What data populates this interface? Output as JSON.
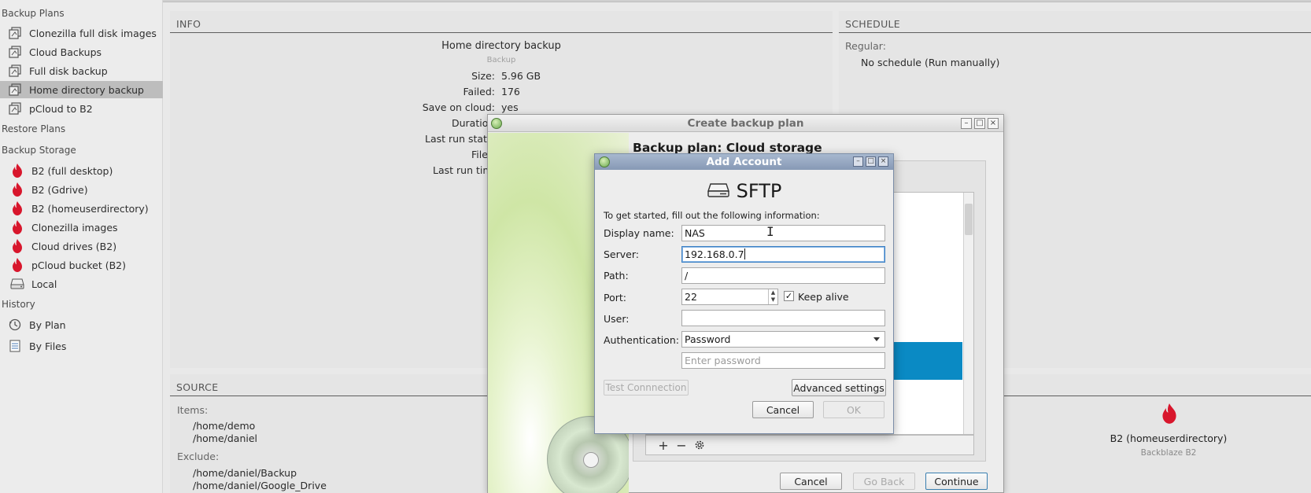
{
  "sidebar": {
    "backup_plans_heading": "Backup Plans",
    "backup_plans": [
      {
        "label": "Clonezilla full disk images"
      },
      {
        "label": "Cloud Backups"
      },
      {
        "label": "Full disk backup"
      },
      {
        "label": "Home directory backup",
        "selected": true
      },
      {
        "label": "pCloud to B2"
      }
    ],
    "restore_plans_heading": "Restore Plans",
    "backup_storage_heading": "Backup Storage",
    "storage": [
      {
        "label": "B2 (full desktop)",
        "icon": "backblaze-flame-icon"
      },
      {
        "label": "B2 (Gdrive)",
        "icon": "backblaze-flame-icon"
      },
      {
        "label": "B2 (homeuserdirectory)",
        "icon": "backblaze-flame-icon"
      },
      {
        "label": "Clonezilla images",
        "icon": "backblaze-flame-icon"
      },
      {
        "label": "Cloud drives (B2)",
        "icon": "backblaze-flame-icon"
      },
      {
        "label": "pCloud bucket (B2)",
        "icon": "backblaze-flame-icon"
      },
      {
        "label": "Local",
        "icon": "hard-drive-icon"
      }
    ],
    "history_heading": "History",
    "history": [
      {
        "label": "By Plan",
        "icon": "clock-history-icon"
      },
      {
        "label": "By Files",
        "icon": "file-list-icon"
      }
    ]
  },
  "info": {
    "heading": "INFO",
    "plan_name": "Home directory backup",
    "plan_type": "Backup",
    "size_label": "Size:",
    "size_value": "5.96 GB",
    "failed_label": "Failed:",
    "failed_value": "176",
    "cloud_label": "Save on cloud:",
    "cloud_value": "yes",
    "duration_label": "Duratio",
    "last_status_label": "Last run statu",
    "files_label": "File",
    "last_time_label": "Last run tim"
  },
  "schedule": {
    "heading": "SCHEDULE",
    "regular_label": "Regular:",
    "regular_value": "No schedule (Run manually)"
  },
  "source": {
    "heading": "SOURCE",
    "items_label": "Items:",
    "items": [
      "/home/demo",
      "/home/daniel"
    ],
    "exclude_label": "Exclude:",
    "exclude": [
      "/home/daniel/Backup",
      "/home/daniel/Google_Drive"
    ]
  },
  "destination": {
    "name": "B2 (homeuserdirectory)",
    "provider": "Backblaze B2"
  },
  "wizard": {
    "title": "Create backup plan",
    "heading": "Backup plan: Cloud storage",
    "cancel_label": "Cancel",
    "back_label": "Go Back",
    "continue_label": "Continue"
  },
  "add_account": {
    "title": "Add Account",
    "protocol": "SFTP",
    "intro": "To get started, fill out the following information:",
    "display_name_label": "Display name:",
    "display_name_value": "NAS",
    "server_label": "Server:",
    "server_value": "192.168.0.7",
    "path_label": "Path:",
    "path_value": "/",
    "port_label": "Port:",
    "port_value": "22",
    "keep_alive_label": "Keep alive",
    "keep_alive_checked": true,
    "user_label": "User:",
    "user_value": "",
    "auth_label": "Authentication:",
    "auth_value": "Password",
    "password_placeholder": "Enter password",
    "test_label": "Test Connnection",
    "advanced_label": "Advanced settings",
    "cancel_label": "Cancel",
    "ok_label": "OK"
  },
  "colors": {
    "selection_blue": "#0a8ac4",
    "backblaze_red": "#d8162c",
    "dialog_title": "#8799b5"
  }
}
